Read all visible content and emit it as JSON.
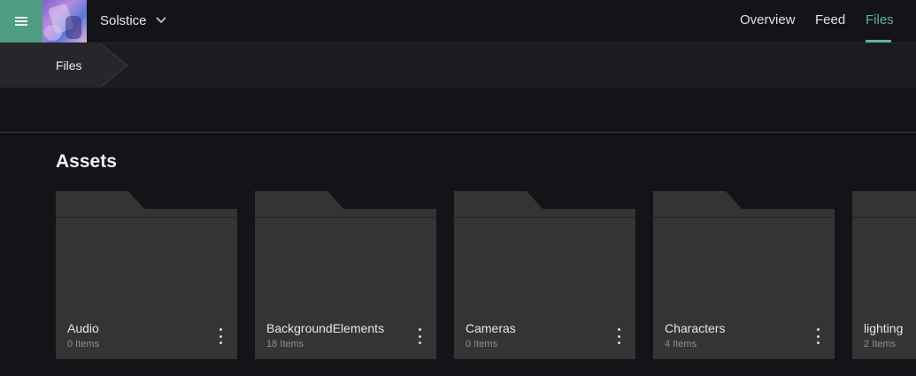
{
  "header": {
    "project_name": "Solstice",
    "project_thumbnail_icon": "project-artwork",
    "menu_icon": "hamburger-icon",
    "accent_color": "#4f9d82",
    "tabs": [
      {
        "label": "Overview",
        "active": false
      },
      {
        "label": "Feed",
        "active": false
      },
      {
        "label": "Files",
        "active": true
      }
    ]
  },
  "breadcrumb": {
    "items": [
      "Files"
    ]
  },
  "section": {
    "title": "Assets"
  },
  "folders": [
    {
      "name": "Audio",
      "count": "0 Items"
    },
    {
      "name": "BackgroundElements",
      "count": "18 Items"
    },
    {
      "name": "Cameras",
      "count": "0 Items"
    },
    {
      "name": "Characters",
      "count": "4 Items"
    },
    {
      "name": "lighting",
      "count": "2 Items"
    }
  ]
}
